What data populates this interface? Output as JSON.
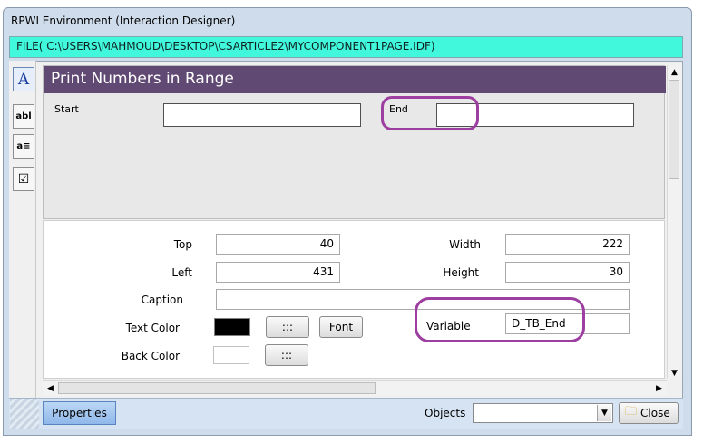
{
  "window": {
    "title": "RPWI Environment (Interaction Designer)"
  },
  "file_bar": {
    "text": "FILE( C:\\USERS\\MAHMOUD\\DESKTOP\\CSARTICLE2\\MYCOMPONENT1PAGE.IDF)"
  },
  "toolbox": {
    "items": [
      {
        "icon": "text-label-icon",
        "glyph": "A"
      },
      {
        "icon": "textbox-icon",
        "glyph": "abl"
      },
      {
        "icon": "listbox-icon",
        "glyph": "a≡"
      },
      {
        "icon": "checkbox-icon",
        "glyph": "☑"
      }
    ]
  },
  "form": {
    "title": "Print Numbers in Range",
    "start_label": "Start",
    "end_label": "End",
    "header_color": "#604973"
  },
  "properties": {
    "top_label": "Top",
    "top_value": "40",
    "left_label": "Left",
    "left_value": "431",
    "width_label": "Width",
    "width_value": "222",
    "height_label": "Height",
    "height_value": "30",
    "caption_label": "Caption",
    "caption_value": "",
    "text_color_label": "Text Color",
    "text_color_value": "#000000",
    "back_color_label": "Back Color",
    "back_color_value": "#ffffff",
    "ellipsis_label": ":::",
    "font_button": "Font",
    "variable_label": "Variable",
    "variable_value": "D_TB_End"
  },
  "bottom_bar": {
    "properties_tab": "Properties",
    "objects_label": "Objects",
    "objects_value": "",
    "close_button": "Close"
  },
  "highlight_color": "#9c3fa0"
}
